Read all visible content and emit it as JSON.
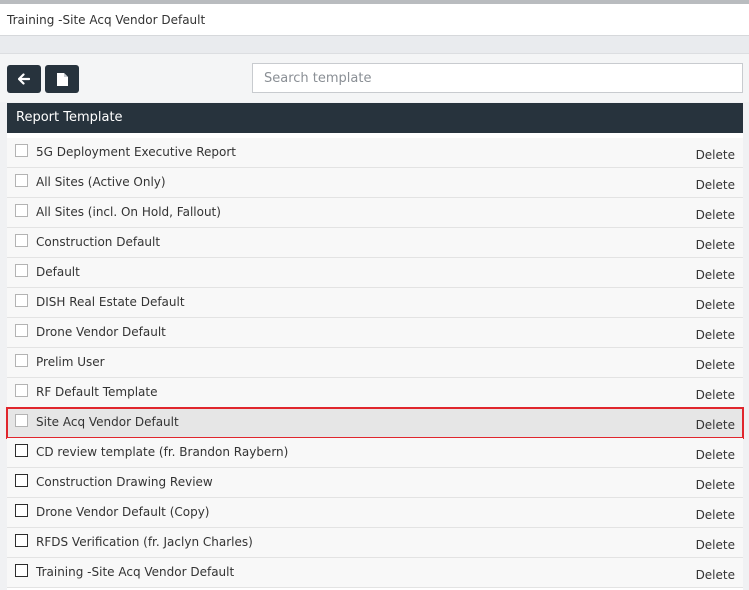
{
  "window": {
    "title": "Training -Site Acq Vendor Default"
  },
  "toolbar": {
    "back_icon": "arrow-left-icon",
    "new_icon": "document-icon",
    "search_placeholder": "Search template",
    "search_value": ""
  },
  "table": {
    "header": "Report Template",
    "delete_label": "Delete",
    "rows": [
      {
        "name": "5G Deployment Executive Report",
        "checkbox_style": "light"
      },
      {
        "name": "All Sites (Active Only)",
        "checkbox_style": "light"
      },
      {
        "name": "All Sites (incl. On Hold, Fallout)",
        "checkbox_style": "light"
      },
      {
        "name": "Construction Default",
        "checkbox_style": "light"
      },
      {
        "name": "Default",
        "checkbox_style": "light"
      },
      {
        "name": "DISH Real Estate Default",
        "checkbox_style": "light"
      },
      {
        "name": "Drone Vendor Default",
        "checkbox_style": "light"
      },
      {
        "name": "Prelim User",
        "checkbox_style": "light"
      },
      {
        "name": "RF Default Template",
        "checkbox_style": "light"
      },
      {
        "name": "Site Acq Vendor Default",
        "checkbox_style": "light",
        "selected": true
      },
      {
        "name": "CD review template (fr. Brandon Raybern)",
        "checkbox_style": "dark"
      },
      {
        "name": "Construction Drawing Review",
        "checkbox_style": "dark"
      },
      {
        "name": "Drone Vendor Default (Copy)",
        "checkbox_style": "dark"
      },
      {
        "name": "RFDS Verification (fr. Jaclyn Charles)",
        "checkbox_style": "dark"
      },
      {
        "name": "Training -Site Acq Vendor Default",
        "checkbox_style": "dark"
      }
    ]
  },
  "colors": {
    "header_bg": "#27333d",
    "selection_outline": "#e0262d",
    "selected_row_bg": "#e6e6e6"
  }
}
